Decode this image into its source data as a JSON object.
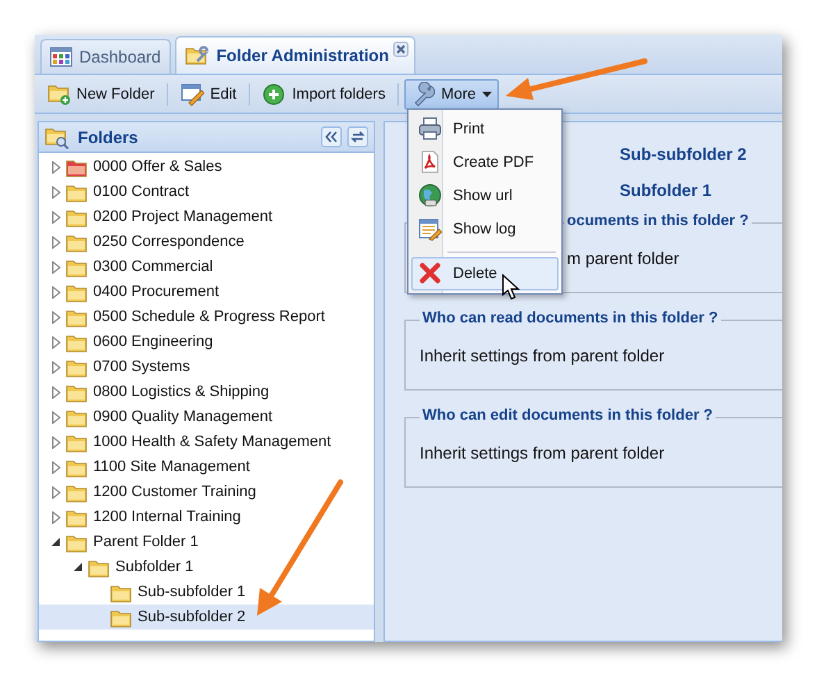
{
  "tabs": [
    {
      "label": "Dashboard",
      "selected": false,
      "closable": false
    },
    {
      "label": "Folder Administration",
      "selected": true,
      "closable": true
    }
  ],
  "toolbar": [
    {
      "kind": "button",
      "label": "New Folder",
      "pressed": false
    },
    {
      "kind": "button",
      "label": "Edit",
      "pressed": false
    },
    {
      "kind": "button",
      "label": "Import folders",
      "pressed": false
    },
    {
      "kind": "menu-button",
      "label": "More",
      "pressed": true
    }
  ],
  "folders_panel": {
    "title": "Folders",
    "tree": [
      {
        "label": "0000 Offer & Sales",
        "color": "#e0404a",
        "expanded": false,
        "selected": false
      },
      {
        "label": "0100 Contract",
        "color": "#f0c850",
        "expanded": false,
        "selected": false
      },
      {
        "label": "0200 Project Management",
        "color": "#f0c850",
        "expanded": false,
        "selected": false
      },
      {
        "label": "0250 Correspondence",
        "color": "#f0c850",
        "expanded": false,
        "selected": false
      },
      {
        "label": "0300 Commercial",
        "color": "#f0c850",
        "expanded": false,
        "selected": false
      },
      {
        "label": "0400 Procurement",
        "color": "#f0c850",
        "expanded": false,
        "selected": false
      },
      {
        "label": "0500 Schedule & Progress Report",
        "color": "#f0c850",
        "expanded": false,
        "selected": false
      },
      {
        "label": "0600 Engineering",
        "color": "#f0c850",
        "expanded": false,
        "selected": false
      },
      {
        "label": "0700 Systems",
        "color": "#f0c850",
        "expanded": false,
        "selected": false
      },
      {
        "label": "0800 Logistics & Shipping",
        "color": "#f0c850",
        "expanded": false,
        "selected": false
      },
      {
        "label": "0900 Quality Management",
        "color": "#f0c850",
        "expanded": false,
        "selected": false
      },
      {
        "label": "1000 Health & Safety Management",
        "color": "#f0c850",
        "expanded": false,
        "selected": false
      },
      {
        "label": "1100 Site Management",
        "color": "#f0c850",
        "expanded": false,
        "selected": false
      },
      {
        "label": "1200 Customer Training",
        "color": "#f0c850",
        "expanded": false,
        "selected": false
      },
      {
        "label": "1200 Internal Training",
        "color": "#f0c850",
        "expanded": false,
        "selected": false
      },
      {
        "label": "Parent Folder 1",
        "color": "#f0c850",
        "expanded": true,
        "selected": false,
        "children": [
          {
            "label": "Subfolder 1",
            "color": "#f0c850",
            "expanded": true,
            "selected": false,
            "children": [
              {
                "label": "Sub-subfolder 1",
                "color": "#f0c850",
                "selected": false
              },
              {
                "label": "Sub-subfolder 2",
                "color": "#f0c850",
                "selected": true
              }
            ]
          }
        ]
      }
    ]
  },
  "details": {
    "fields": [
      {
        "value": "Sub-subfolder 2"
      },
      {
        "value": "Subfolder 1"
      }
    ],
    "sections": [
      {
        "legend": "ocuments in this folder ?",
        "text": "m parent folder"
      },
      {
        "legend": "Who can read documents in this folder ?",
        "text": "Inherit settings from parent folder"
      },
      {
        "legend": "Who can edit documents in this folder ?",
        "text": "Inherit settings from parent folder"
      }
    ]
  },
  "more_menu": [
    {
      "kind": "item",
      "label": "Print",
      "highlighted": false
    },
    {
      "kind": "item",
      "label": "Create PDF",
      "highlighted": false
    },
    {
      "kind": "item",
      "label": "Show url",
      "highlighted": false
    },
    {
      "kind": "item",
      "label": "Show log",
      "highlighted": false
    },
    {
      "kind": "separator"
    },
    {
      "kind": "item",
      "label": "Delete",
      "highlighted": true
    }
  ]
}
